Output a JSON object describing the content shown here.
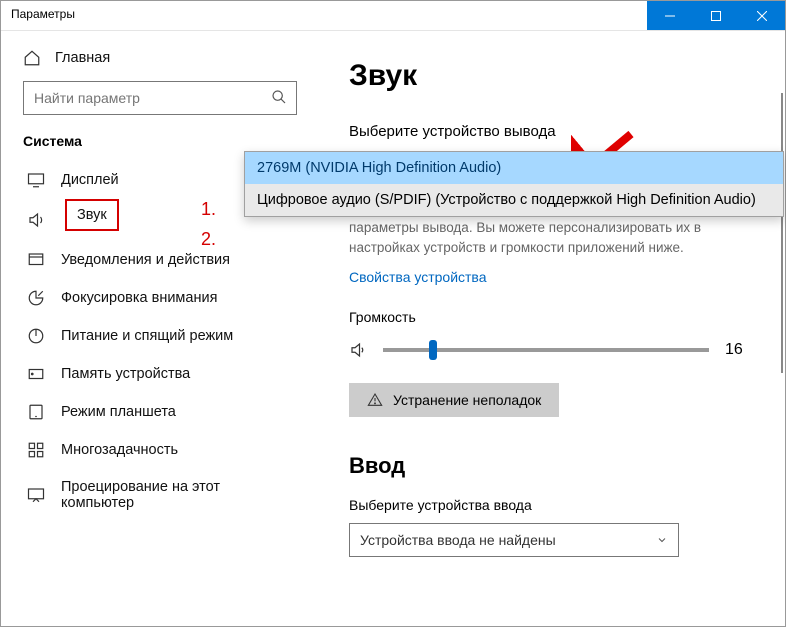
{
  "titlebar": {
    "title": "Параметры"
  },
  "sidebar": {
    "home": "Главная",
    "search_placeholder": "Найти параметр",
    "section": "Система",
    "items": [
      {
        "label": "Дисплей"
      },
      {
        "label": "Звук"
      },
      {
        "label": "Уведомления и действия"
      },
      {
        "label": "Фокусировка внимания"
      },
      {
        "label": "Питание и спящий режим"
      },
      {
        "label": "Память устройства"
      },
      {
        "label": "Режим планшета"
      },
      {
        "label": "Многозадачность"
      },
      {
        "label": "Проецирование на этот компьютер"
      }
    ]
  },
  "annotations": {
    "one": "1.",
    "two": "2."
  },
  "main": {
    "heading": "Звук",
    "output_label": "Выберите устройство вывода",
    "dropdown": {
      "option1": "2769M (NVIDIA High Definition Audio)",
      "option2": "Цифровое аудио (S/PDIF) (Устройство с поддержкой High Definition Audio)"
    },
    "desc": "параметры вывода. Вы можете персонализировать их в настройках устройств и громкости приложений ниже.",
    "props_link": "Свойства устройства",
    "volume_label": "Громкость",
    "volume_value": "16",
    "troubleshoot": "Устранение неполадок",
    "input_heading": "Ввод",
    "input_label": "Выберите устройства ввода",
    "input_select": "Устройства ввода не найдены"
  }
}
